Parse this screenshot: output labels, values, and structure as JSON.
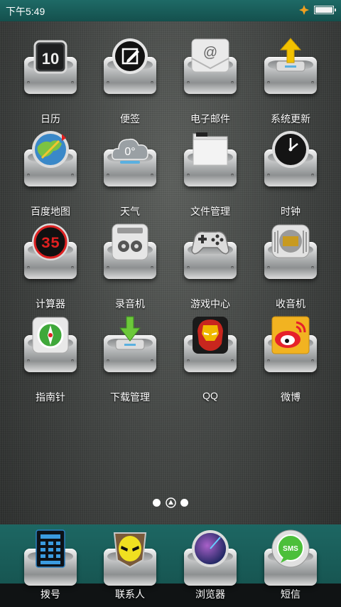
{
  "status": {
    "time": "下午5:49",
    "battery_level": 1.0
  },
  "apps": [
    {
      "label": "日历",
      "icon": "calendar-icon",
      "badge": "10"
    },
    {
      "label": "便签",
      "icon": "notes-icon"
    },
    {
      "label": "电子邮件",
      "icon": "email-icon",
      "badge": "@"
    },
    {
      "label": "系统更新",
      "icon": "system-update-icon"
    },
    {
      "label": "百度地图",
      "icon": "map-icon"
    },
    {
      "label": "天气",
      "icon": "weather-cloud-icon",
      "badge": "0°"
    },
    {
      "label": "文件管理",
      "icon": "folder-icon"
    },
    {
      "label": "时钟",
      "icon": "clock-icon"
    },
    {
      "label": "计算器",
      "icon": "calculator-icon",
      "badge": "35"
    },
    {
      "label": "录音机",
      "icon": "recorder-icon"
    },
    {
      "label": "游戏中心",
      "icon": "gamepad-icon"
    },
    {
      "label": "收音机",
      "icon": "radio-icon"
    },
    {
      "label": "指南针",
      "icon": "compass-icon"
    },
    {
      "label": "下载管理",
      "icon": "download-icon"
    },
    {
      "label": "QQ",
      "icon": "ironman-mask-icon"
    },
    {
      "label": "微博",
      "icon": "weibo-icon"
    }
  ],
  "pager": {
    "pages": 3,
    "current": 1
  },
  "dock": [
    {
      "label": "拨号",
      "icon": "dialpad-icon"
    },
    {
      "label": "联系人",
      "icon": "alien-contact-icon"
    },
    {
      "label": "浏览器",
      "icon": "browser-globe-icon"
    },
    {
      "label": "短信",
      "icon": "sms-bubble-icon",
      "badge": "SMS"
    }
  ]
}
